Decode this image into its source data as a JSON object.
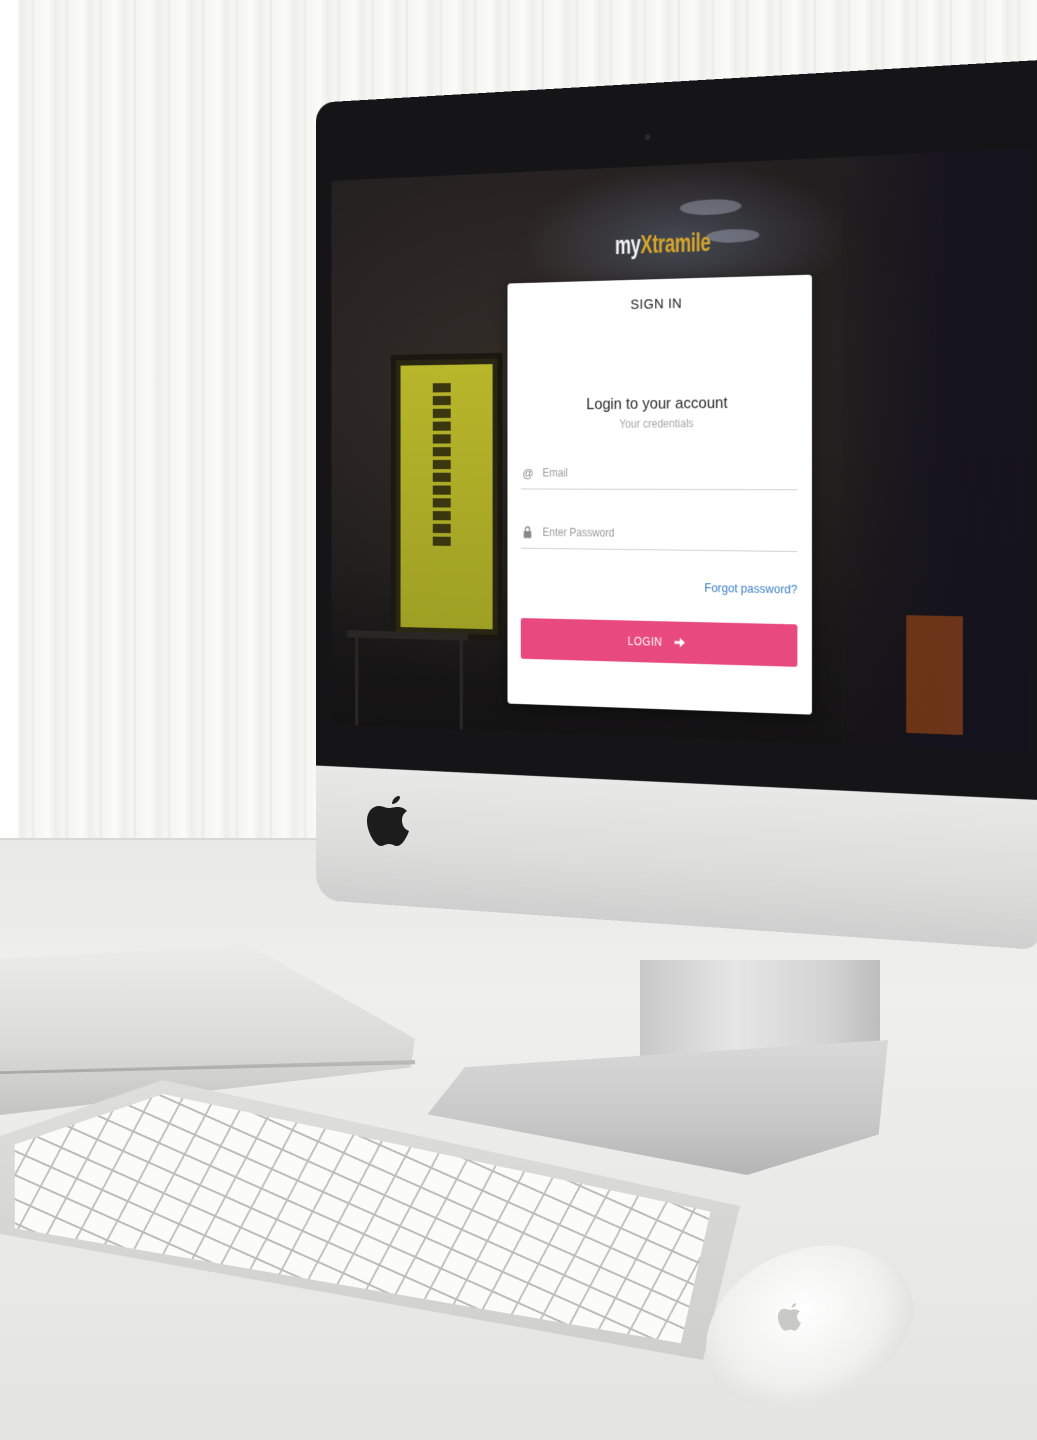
{
  "logo": {
    "prefix": "my",
    "brand": "Xtramile"
  },
  "card": {
    "title": "SIGN IN",
    "heading": "Login to your account",
    "subheading": "Your credentials"
  },
  "form": {
    "email_placeholder": "Email",
    "email_value": "",
    "password_placeholder": "Enter Password",
    "password_value": "",
    "forgot_label": "Forgot password?",
    "login_label": "LOGIN"
  },
  "icons": {
    "email": "at-sign-icon",
    "password": "lock-icon",
    "login": "arrow-right-icon"
  },
  "colors": {
    "accent": "#e84a7f",
    "link": "#3b7ec4",
    "brand_gold": "#d4a52c"
  }
}
